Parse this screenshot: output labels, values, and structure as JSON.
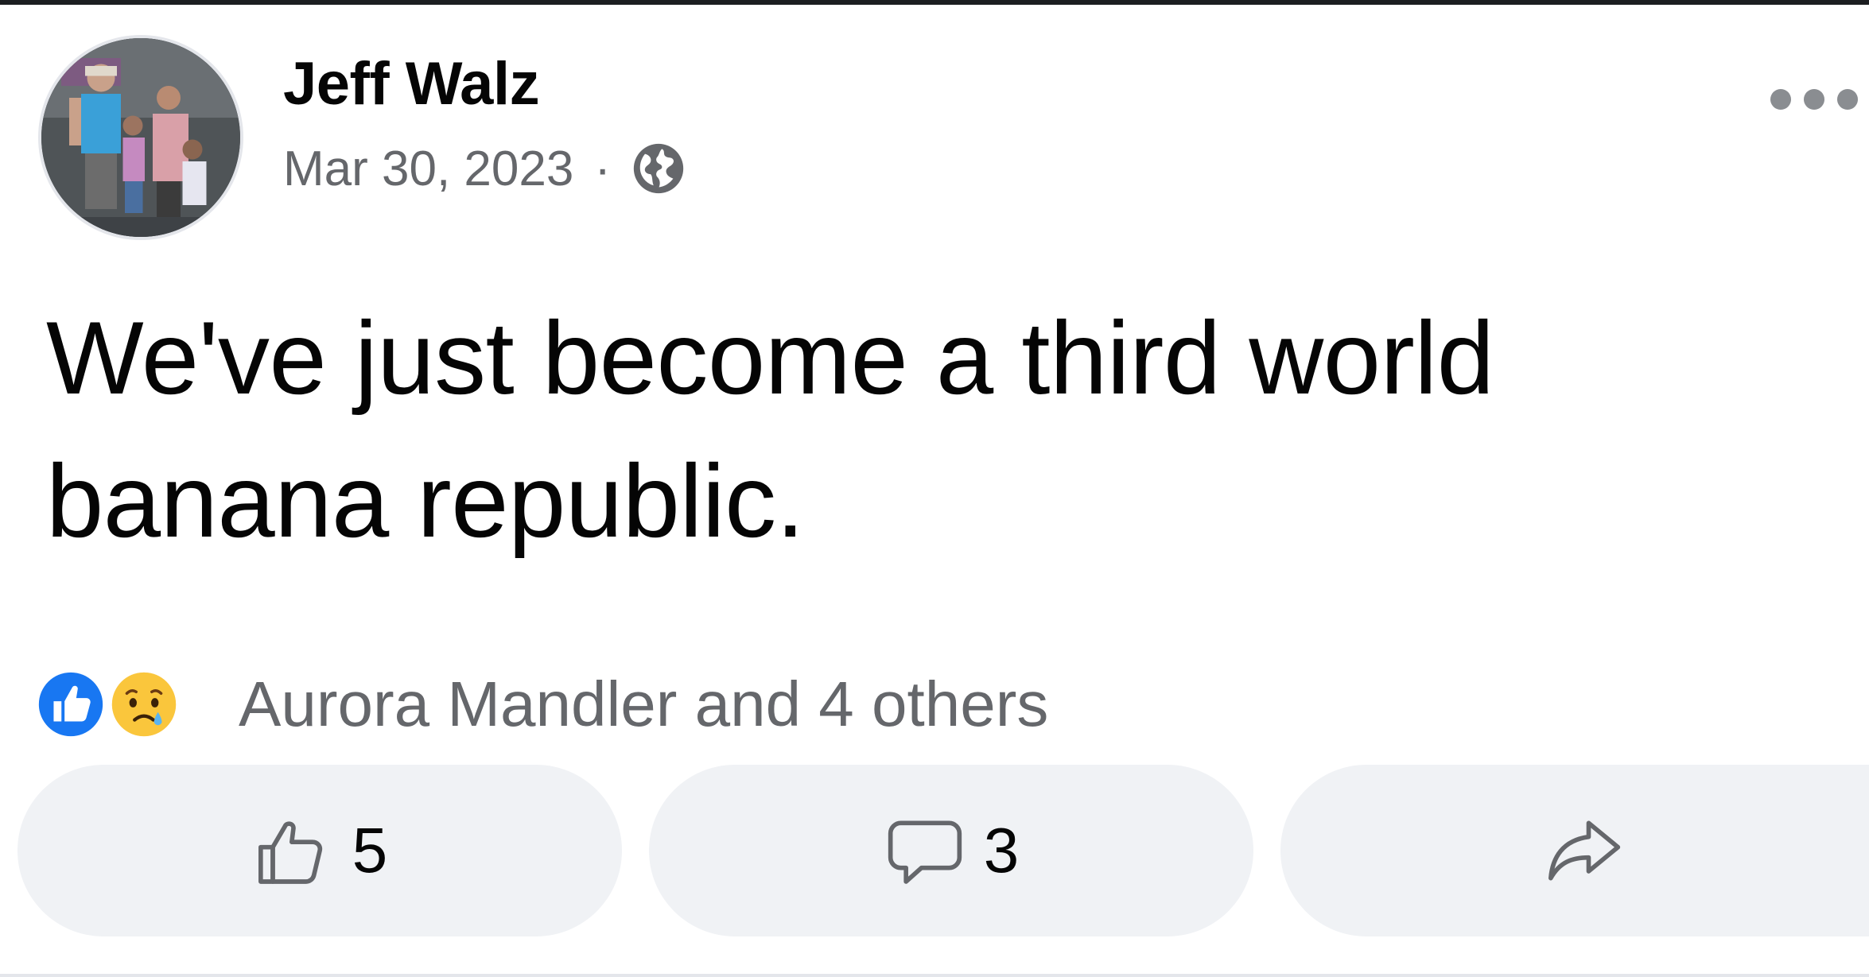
{
  "post": {
    "author": "Jeff Walz",
    "date": "Mar 30, 2023",
    "separator": "·",
    "privacy_icon": "globe-icon",
    "text": "We've just become a third world banana republic."
  },
  "reactions": {
    "icons": [
      "like-reaction-icon",
      "sad-reaction-icon"
    ],
    "summary": "Aurora Mandler and 4 others"
  },
  "actions": {
    "like_count": "5",
    "comment_count": "3",
    "share_icon": "share-icon"
  },
  "colors": {
    "like_blue": "#1877f2",
    "secondary_text": "#65676b",
    "button_background": "#f0f2f5"
  }
}
